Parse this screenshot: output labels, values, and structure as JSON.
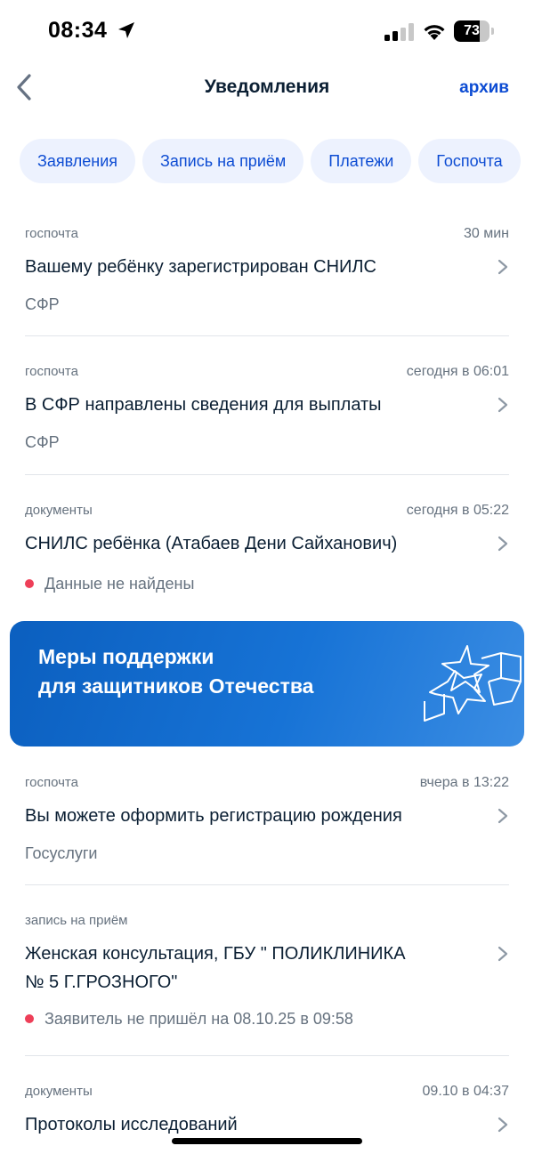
{
  "status_bar": {
    "time": "08:34",
    "battery": "73",
    "battery_level": 0.73
  },
  "nav": {
    "title": "Уведомления",
    "archive": "архив"
  },
  "chips": [
    "Заявления",
    "Запись на приём",
    "Платежи",
    "Госпочта"
  ],
  "notifications": [
    {
      "category": "госпочта",
      "time": "30 мин",
      "title": "Вашему ребёнку зарегистрирован СНИЛС",
      "sub": "СФР"
    },
    {
      "category": "госпочта",
      "time": "сегодня в 06:01",
      "title": "В СФР направлены сведения для выплаты",
      "sub": "СФР"
    },
    {
      "category": "документы",
      "time": "сегодня в 05:22",
      "title": "СНИЛС ребёнка (Атабаев Дени Сайханович)",
      "status": "Данные не найдены"
    },
    {
      "category": "госпочта",
      "time": "вчера в 13:22",
      "title": "Вы можете оформить регистрацию рождения",
      "sub": "Госуслуги"
    },
    {
      "category": "запись на приём",
      "time": "",
      "title_line1": "Женская консультация, ГБУ \" ПОЛИКЛИНИКА",
      "title_line2": "№ 5 Г.ГРОЗНОГО\"",
      "status": "Заявитель не пришёл на 08.10.25 в 09:58"
    },
    {
      "category": "документы",
      "time": "09.10 в 04:37",
      "title": "Протоколы исследований"
    }
  ],
  "banner": {
    "line1": "Меры поддержки",
    "line2": "для защитников Отечества"
  },
  "icons": {
    "back": "chevron-left-icon",
    "chevron": "chevron-right-icon",
    "location": "location-arrow-icon",
    "banner": "star-flag-icon"
  },
  "colors": {
    "accent": "#0d4cd3",
    "chip_bg": "#edf2fe",
    "status_red": "#ee3f58",
    "banner_start": "#0b5fbf",
    "banner_end": "#3b8de3"
  }
}
